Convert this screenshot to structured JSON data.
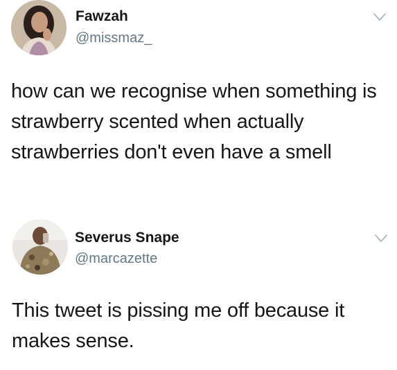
{
  "tweets": [
    {
      "display_name": "Fawzah",
      "handle": "@missmaz_",
      "text": "how can we recognise when something is strawberry scented when actually strawberries don't even have a smell",
      "avatar_icon": "profile-photo-woman",
      "menu_icon": "chevron-down-icon"
    },
    {
      "display_name": "Severus Snape",
      "handle": "@marcazette",
      "text": "This tweet is pissing me off because it makes sense.",
      "avatar_icon": "profile-photo-man",
      "menu_icon": "chevron-down-icon"
    }
  ],
  "colors": {
    "text": "#14171a",
    "secondary": "#657786",
    "chevron": "#aab8c2",
    "background": "#ffffff"
  }
}
